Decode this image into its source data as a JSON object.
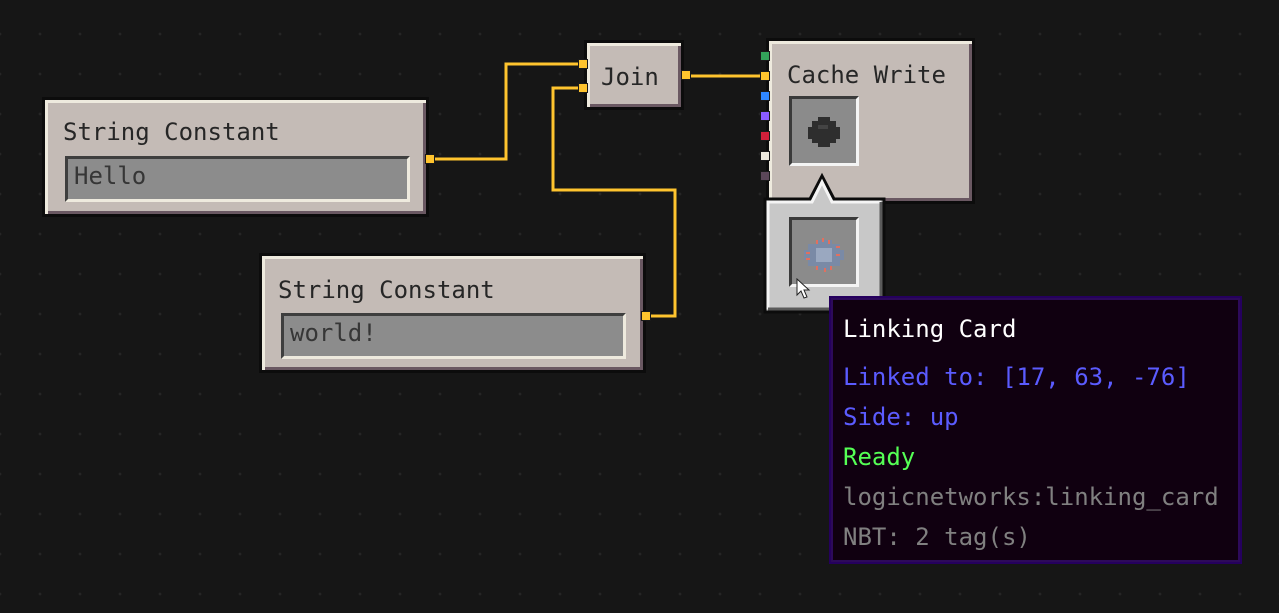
{
  "nodes": {
    "string_constant_1": {
      "title": "String Constant",
      "value": "Hello"
    },
    "string_constant_2": {
      "title": "String Constant",
      "value": "world!"
    },
    "join": {
      "title": "Join"
    },
    "cache_write": {
      "title": "Cache Write",
      "slot_item_icon": "dark-blob-icon",
      "input_port_colors": [
        "#33a35a",
        "#ffc42e",
        "#2f86ff",
        "#8a5cff",
        "#d0203a",
        "#eeeadf",
        "#5b4759"
      ]
    }
  },
  "wire_color": "#ffc42e",
  "popup": {
    "slot_item_icon": "linking-card-icon"
  },
  "tooltip": {
    "title": "Linking Card",
    "linked_to": "Linked to: [17, 63, -76]",
    "side": "Side: up",
    "status": "Ready",
    "item_id": "logicnetworks:linking_card",
    "nbt": "NBT: 2 tag(s)",
    "colors": {
      "title": "#ffffff",
      "linked_to": "#5b5bff",
      "side": "#5b5bff",
      "status": "#55ff55",
      "item_id": "#808080",
      "nbt": "#808080"
    }
  }
}
